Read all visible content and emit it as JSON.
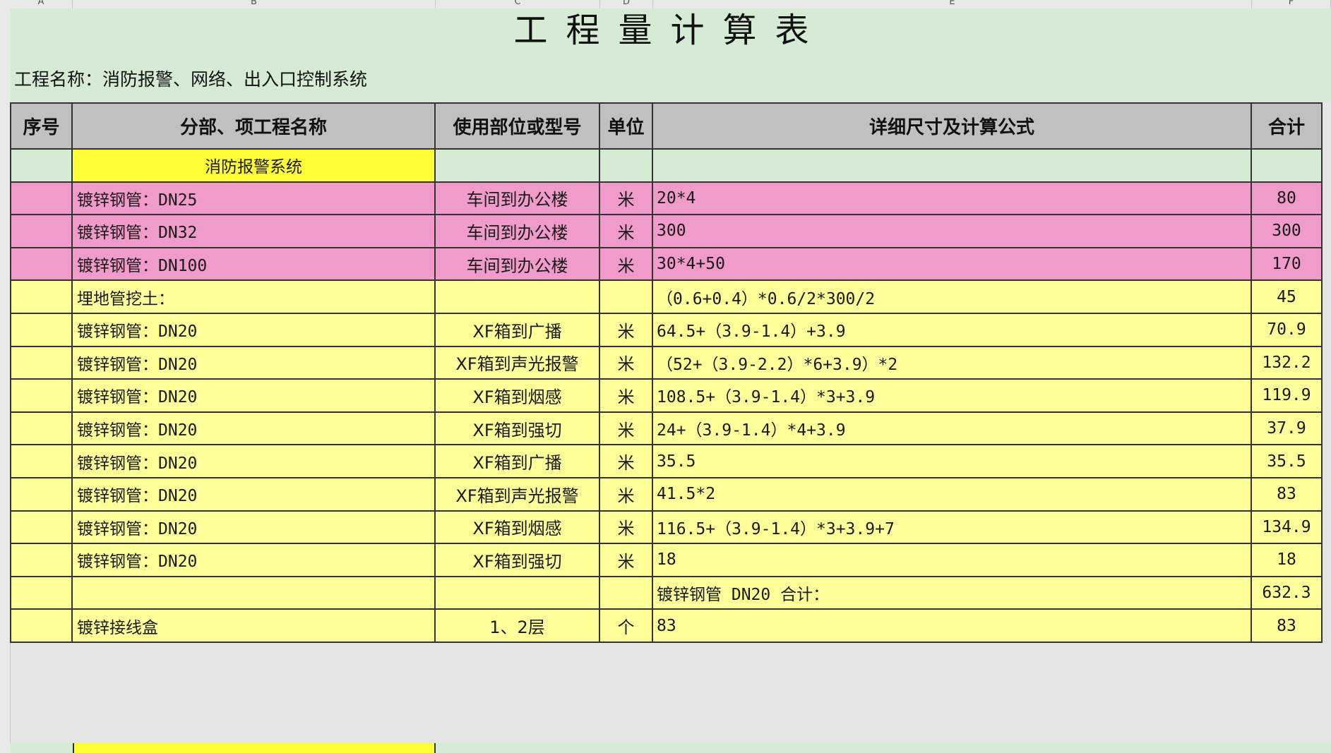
{
  "column_headers": [
    "A",
    "B",
    "C",
    "D",
    "E",
    "F"
  ],
  "title": "工程量计算表",
  "project_name": "工程名称：消防报警、网络、出入口控制系统",
  "table": {
    "headers": [
      "序号",
      "分部、项工程名称",
      "使用部位或型号",
      "单位",
      "详细尺寸及计算公式",
      "合计"
    ],
    "rows": [
      {
        "no": "",
        "name": "消防报警系统",
        "location": "",
        "unit": "",
        "formula": "",
        "total": "",
        "style": "section"
      },
      {
        "no": "",
        "name": "镀锌钢管：DN25",
        "location": "车间到办公楼",
        "unit": "米",
        "formula": "20*4",
        "total": "80",
        "style": "pink"
      },
      {
        "no": "",
        "name": "镀锌钢管：DN32",
        "location": "车间到办公楼",
        "unit": "米",
        "formula": "300",
        "total": "300",
        "style": "pink"
      },
      {
        "no": "",
        "name": "镀锌钢管：DN100",
        "location": "车间到办公楼",
        "unit": "米",
        "formula": "30*4+50",
        "total": "170",
        "style": "pink"
      },
      {
        "no": "",
        "name": "埋地管挖土：",
        "location": "",
        "unit": "",
        "formula": "（0.6+0.4）*0.6/2*300/2",
        "total": "45",
        "style": "yellow"
      },
      {
        "no": "",
        "name": "镀锌钢管：DN20",
        "location": "XF箱到广播",
        "unit": "米",
        "formula": "64.5+（3.9-1.4）+3.9",
        "total": "70.9",
        "style": "yellow"
      },
      {
        "no": "",
        "name": "镀锌钢管：DN20",
        "location": "XF箱到声光报警",
        "unit": "米",
        "formula": "（52+（3.9-2.2）*6+3.9）*2",
        "total": "132.2",
        "style": "yellow"
      },
      {
        "no": "",
        "name": "镀锌钢管：DN20",
        "location": "XF箱到烟感",
        "unit": "米",
        "formula": "108.5+（3.9-1.4）*3+3.9",
        "total": "119.9",
        "style": "yellow"
      },
      {
        "no": "",
        "name": "镀锌钢管：DN20",
        "location": "XF箱到强切",
        "unit": "米",
        "formula": "24+（3.9-1.4）*4+3.9",
        "total": "37.9",
        "style": "yellow"
      },
      {
        "no": "",
        "name": "镀锌钢管：DN20",
        "location": "XF箱到广播",
        "unit": "米",
        "formula": "35.5",
        "total": "35.5",
        "style": "yellow"
      },
      {
        "no": "",
        "name": "镀锌钢管：DN20",
        "location": "XF箱到声光报警",
        "unit": "米",
        "formula": "41.5*2",
        "total": "83",
        "style": "yellow"
      },
      {
        "no": "",
        "name": "镀锌钢管：DN20",
        "location": "XF箱到烟感",
        "unit": "米",
        "formula": "116.5+（3.9-1.4）*3+3.9+7",
        "total": "134.9",
        "style": "yellow"
      },
      {
        "no": "",
        "name": "镀锌钢管：DN20",
        "location": "XF箱到强切",
        "unit": "米",
        "formula": "18",
        "total": "18",
        "style": "yellow"
      },
      {
        "no": "",
        "name": "",
        "location": "",
        "unit": "",
        "formula": "镀锌钢管 DN20 合计：",
        "total": "632.3",
        "style": "yellow"
      },
      {
        "no": "",
        "name": "镀锌接线盒",
        "location": "1、2层",
        "unit": "个",
        "formula": "83",
        "total": "83",
        "style": "yellow"
      }
    ]
  },
  "colors": {
    "sheet_green": "#d5ebd3",
    "header_gray": "#c0c0c0",
    "section_yellow": "#ffff38",
    "row_yellow": "#ffff9a",
    "row_pink": "#f09bc9"
  }
}
